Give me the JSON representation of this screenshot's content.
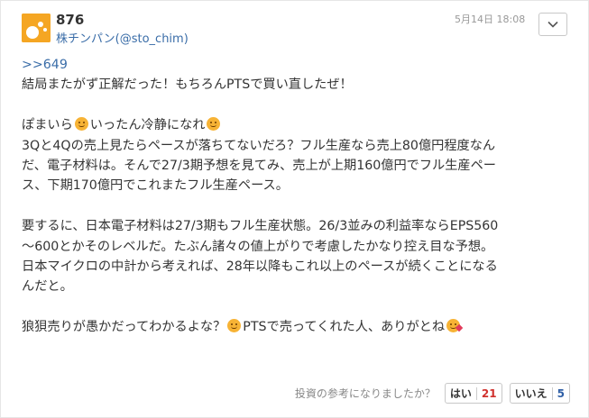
{
  "post": {
    "number": "876",
    "author": "株チンパン(@sto_chim)",
    "timestamp": "5月14日 18:08",
    "menu_icon": "chevron-down-icon",
    "avatar_color": "#f5a623"
  },
  "body": {
    "reply_link": ">>649",
    "line1": "結局またがず正解だった！もちろんPTSで買い直したぜ！",
    "line2_a": "ぽまいら",
    "line2_b": "いったん冷静になれ",
    "line3": "3Qと4Qの売上見たらペースが落ちてないだろ？フル生産なら売上80億円程度なん",
    "line4": "だ、電子材料は。そんで27/3期予想を見てみ、売上が上期160億円でフル生産ペー",
    "line5": "ス、下期170億円でこれまたフル生産ペース。",
    "line6": "要するに、日本電子材料は27/3期もフル生産状態。26/3並みの利益率ならEPS560",
    "line7": "～600とかそのレベルだ。たぶん諸々の値上がりで考慮したかなり控え目な予想。",
    "line8": "日本マイクロの中計から考えれば、28年以降もこれ以上のペースが続くことになる",
    "line9": "んだと。",
    "line10_a": "狼狽売りが愚かだってわかるよな？",
    "line10_b": "PTSで売ってくれた人、ありがとね"
  },
  "footer": {
    "question": "投資の参考になりましたか？",
    "yes_label": "はい",
    "yes_count": "21",
    "no_label": "いいえ",
    "no_count": "5"
  },
  "colors": {
    "link": "#3a6da8",
    "yes_count": "#d0312d",
    "no_count": "#2f5fa6"
  }
}
